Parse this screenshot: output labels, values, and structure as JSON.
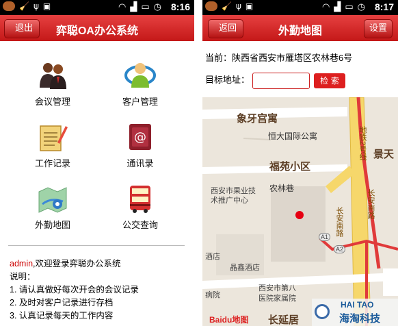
{
  "left_screen": {
    "status": {
      "time": "8:16"
    },
    "titlebar": {
      "back_label": "退出",
      "title": "弈聪OA办公系统"
    },
    "menu": [
      {
        "label": "会议管理",
        "icon": "meeting-icon"
      },
      {
        "label": "客户管理",
        "icon": "customer-icon"
      },
      {
        "label": "工作记录",
        "icon": "notepad-icon"
      },
      {
        "label": "通讯录",
        "icon": "address-book-icon"
      },
      {
        "label": "外勤地图",
        "icon": "map-icon"
      },
      {
        "label": "公交查询",
        "icon": "bus-icon"
      }
    ],
    "welcome": {
      "user": "admin",
      "message": ",欢迎登录弈聪办公系统",
      "note_title": "说明：",
      "notes": [
        "1. 请认真做好每次开会的会议记录",
        "2. 及时对客户记录进行存档",
        "3. 认真记录每天的工作内容"
      ]
    }
  },
  "right_screen": {
    "status": {
      "time": "8:17"
    },
    "titlebar": {
      "back_label": "返回",
      "title": "外勤地图",
      "settings_label": "设置"
    },
    "current_address": "当前：陕西省西安市雁塔区农林巷6号",
    "target_label": "目标地址：",
    "target_value": "",
    "search_label": "检 索",
    "map_labels": {
      "l1": "象牙宫寓",
      "l2": "恒大国际公寓",
      "l3": "福苑小区",
      "l4": "西安市果业技",
      "l5": "术推广中心",
      "l6": "农林巷",
      "l7": "酒店",
      "l8": "晶鑫酒店",
      "l9": "病院",
      "l10": "西安市第八",
      "l11": "医院家属院",
      "l12": "长延居",
      "l13": "景天",
      "l14": "地铁2号线",
      "l15": "长安南路",
      "l16": "长安南路",
      "l17": "A1",
      "l18": "A2",
      "logo": "Baidu地图"
    },
    "watermark": {
      "top": "HAI TAO",
      "bottom": "海淘科技"
    }
  }
}
